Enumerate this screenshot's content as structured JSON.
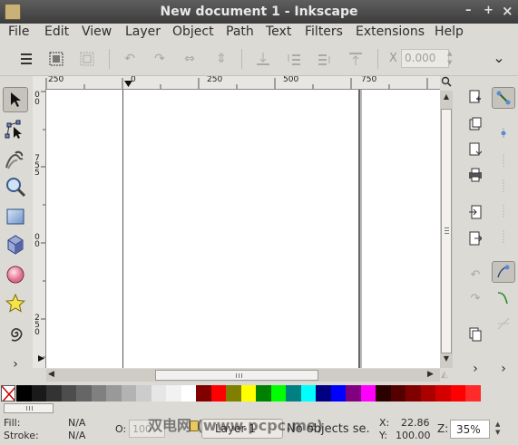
{
  "window": {
    "title": "New document 1 - Inkscape",
    "minimize": "–",
    "maximize": "+",
    "close": "×"
  },
  "menu": [
    "File",
    "Edit",
    "View",
    "Layer",
    "Object",
    "Path",
    "Text",
    "Filters",
    "Extensions",
    "Help"
  ],
  "tool_controls": {
    "x_label": "X",
    "x_value": "0.000",
    "overflow": "⌄"
  },
  "rulers": {
    "horizontal": [
      "250",
      "0",
      "250",
      "500",
      "750"
    ],
    "vertical": [
      "0",
      "0",
      "7",
      "5",
      "5",
      "0",
      "0",
      "2",
      "5",
      "0"
    ]
  },
  "tools": [
    "selector",
    "node",
    "tweak",
    "zoom",
    "rectangle",
    "3d-box",
    "ellipse",
    "star",
    "spiral"
  ],
  "palette": {
    "none_swatch": "none",
    "colors": [
      "#000000",
      "#1a1a1a",
      "#333333",
      "#4d4d4d",
      "#666666",
      "#808080",
      "#999999",
      "#b3b3b3",
      "#cccccc",
      "#e6e6e6",
      "#f2f2f2",
      "#ffffff",
      "#800000",
      "#ff0000",
      "#808000",
      "#ffff00",
      "#008000",
      "#00ff00",
      "#008080",
      "#00ffff",
      "#000080",
      "#0000ff",
      "#800080",
      "#ff00ff",
      "#2b0000",
      "#550000",
      "#800000",
      "#aa0000",
      "#d40000",
      "#ff0000",
      "#ff2a2a"
    ]
  },
  "status": {
    "fill_label": "Fill:",
    "fill_value": "N/A",
    "stroke_label": "Stroke:",
    "stroke_value": "N/A",
    "opacity_label": "O:",
    "opacity_value": "100",
    "layer": "Layer 1",
    "message": "No objects se.",
    "x_label": "X:",
    "x_value": "22.86",
    "y_label": "Y:",
    "y_value": "100.00",
    "z_label": "Z:",
    "zoom_value": "35%"
  },
  "watermark": "双电网 (www.pcpc.me)"
}
